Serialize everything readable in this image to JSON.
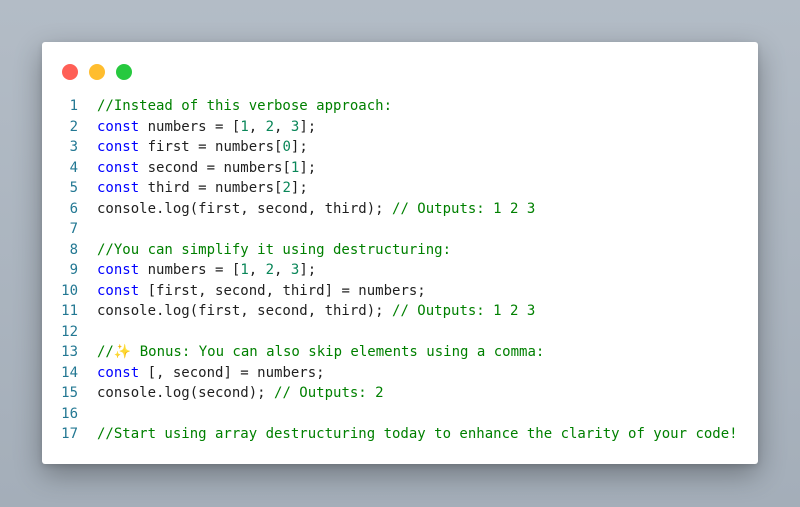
{
  "colors": {
    "background": "#aab3be",
    "window": "#ffffff",
    "close": "#ff5f56",
    "minimize": "#ffbd2e",
    "maximize": "#27c93f",
    "line_number": "#237893",
    "keyword": "#0000ff",
    "number": "#098658",
    "comment": "#008000",
    "text": "#1f1f1f"
  },
  "window_controls": [
    "close-dot",
    "minimize-dot",
    "maximize-dot"
  ],
  "code": {
    "lines": [
      {
        "n": "1",
        "tokens": [
          {
            "t": "cm",
            "v": "//Instead of this verbose approach:"
          }
        ]
      },
      {
        "n": "2",
        "tokens": [
          {
            "t": "kw",
            "v": "const"
          },
          {
            "t": "pl",
            "v": " numbers = ["
          },
          {
            "t": "num",
            "v": "1"
          },
          {
            "t": "pl",
            "v": ", "
          },
          {
            "t": "num",
            "v": "2"
          },
          {
            "t": "pl",
            "v": ", "
          },
          {
            "t": "num",
            "v": "3"
          },
          {
            "t": "pl",
            "v": "];"
          }
        ]
      },
      {
        "n": "3",
        "tokens": [
          {
            "t": "kw",
            "v": "const"
          },
          {
            "t": "pl",
            "v": " first = numbers["
          },
          {
            "t": "num",
            "v": "0"
          },
          {
            "t": "pl",
            "v": "];"
          }
        ]
      },
      {
        "n": "4",
        "tokens": [
          {
            "t": "kw",
            "v": "const"
          },
          {
            "t": "pl",
            "v": " second = numbers["
          },
          {
            "t": "num",
            "v": "1"
          },
          {
            "t": "pl",
            "v": "];"
          }
        ]
      },
      {
        "n": "5",
        "tokens": [
          {
            "t": "kw",
            "v": "const"
          },
          {
            "t": "pl",
            "v": " third = numbers["
          },
          {
            "t": "num",
            "v": "2"
          },
          {
            "t": "pl",
            "v": "];"
          }
        ]
      },
      {
        "n": "6",
        "tokens": [
          {
            "t": "pl",
            "v": "console.log(first, second, third); "
          },
          {
            "t": "cm",
            "v": "// Outputs: 1 2 3"
          }
        ]
      },
      {
        "n": "7",
        "tokens": []
      },
      {
        "n": "8",
        "tokens": [
          {
            "t": "cm",
            "v": "//You can simplify it using destructuring:"
          }
        ]
      },
      {
        "n": "9",
        "tokens": [
          {
            "t": "kw",
            "v": "const"
          },
          {
            "t": "pl",
            "v": " numbers = ["
          },
          {
            "t": "num",
            "v": "1"
          },
          {
            "t": "pl",
            "v": ", "
          },
          {
            "t": "num",
            "v": "2"
          },
          {
            "t": "pl",
            "v": ", "
          },
          {
            "t": "num",
            "v": "3"
          },
          {
            "t": "pl",
            "v": "];"
          }
        ]
      },
      {
        "n": "10",
        "tokens": [
          {
            "t": "kw",
            "v": "const"
          },
          {
            "t": "pl",
            "v": " [first, second, third] = numbers;"
          }
        ]
      },
      {
        "n": "11",
        "tokens": [
          {
            "t": "pl",
            "v": "console.log(first, second, third); "
          },
          {
            "t": "cm",
            "v": "// Outputs: 1 2 3"
          }
        ]
      },
      {
        "n": "12",
        "tokens": []
      },
      {
        "n": "13",
        "tokens": [
          {
            "t": "cm",
            "v": "//✨ Bonus: You can also skip elements using a comma:"
          }
        ]
      },
      {
        "n": "14",
        "tokens": [
          {
            "t": "kw",
            "v": "const"
          },
          {
            "t": "pl",
            "v": " [, second] = numbers;"
          }
        ]
      },
      {
        "n": "15",
        "tokens": [
          {
            "t": "pl",
            "v": "console.log(second); "
          },
          {
            "t": "cm",
            "v": "// Outputs: 2"
          }
        ]
      },
      {
        "n": "16",
        "tokens": []
      },
      {
        "n": "17",
        "tokens": [
          {
            "t": "cm",
            "v": "//Start using array destructuring today to enhance the clarity of your code!"
          }
        ]
      }
    ]
  }
}
